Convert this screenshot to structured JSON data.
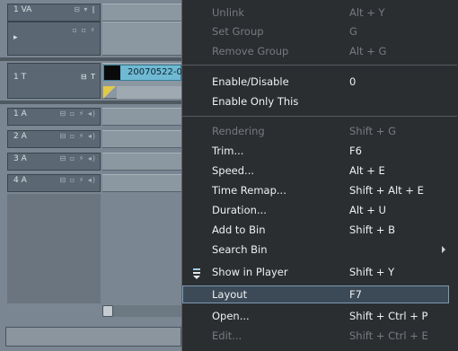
{
  "timeline": {
    "tracks": [
      {
        "name": "1 VA",
        "icons": "⊟ ▾ ∥"
      },
      {
        "name": "",
        "icons": "▫ ▫ ⚡"
      },
      {
        "name": "1 T",
        "icons": "⊟ T"
      },
      {
        "name": "1 A",
        "icons": "⊟ ▫ ⚡ ◂)"
      },
      {
        "name": "2 A",
        "icons": "⊟ ▫ ⚡ ◂)"
      },
      {
        "name": "3 A",
        "icons": "⊟ ▫ ⚡ ◂)"
      },
      {
        "name": "4 A",
        "icons": "⊟ ▫ ⚡ ◂)"
      }
    ],
    "clip_name": "20070522-0"
  },
  "menu": {
    "items": [
      {
        "label": "Unlink",
        "shortcut": "Alt + Y",
        "disabled": true
      },
      {
        "label": "Set Group",
        "shortcut": "G",
        "disabled": true
      },
      {
        "label": "Remove Group",
        "shortcut": "Alt + G",
        "disabled": true
      },
      {
        "label": "Enable/Disable",
        "shortcut": "0",
        "disabled": false
      },
      {
        "label": "Enable Only This",
        "shortcut": "",
        "disabled": false
      },
      {
        "label": "Rendering",
        "shortcut": "Shift + G",
        "disabled": true
      },
      {
        "label": "Trim...",
        "shortcut": "F6",
        "disabled": false
      },
      {
        "label": "Speed...",
        "shortcut": "Alt + E",
        "disabled": false
      },
      {
        "label": "Time Remap...",
        "shortcut": "Shift + Alt + E",
        "disabled": false
      },
      {
        "label": "Duration...",
        "shortcut": "Alt + U",
        "disabled": false
      },
      {
        "label": "Add to Bin",
        "shortcut": "Shift + B",
        "disabled": false
      },
      {
        "label": "Search Bin",
        "shortcut": "",
        "disabled": false,
        "submenu": true
      },
      {
        "label": "Show in Player",
        "shortcut": "Shift + Y",
        "disabled": false,
        "icon": "show-in-player-icon"
      },
      {
        "label": "Layout",
        "shortcut": "F7",
        "disabled": false,
        "selected": true
      },
      {
        "label": "Open...",
        "shortcut": "Shift + Ctrl + P",
        "disabled": false
      },
      {
        "label": "Edit...",
        "shortcut": "Shift + Ctrl + E",
        "disabled": true
      }
    ]
  },
  "colors": {
    "menu_bg": "#2b2e31",
    "selection": "#3c4a58",
    "clip": "#6fb9d3",
    "marker": "#e2c84b"
  }
}
